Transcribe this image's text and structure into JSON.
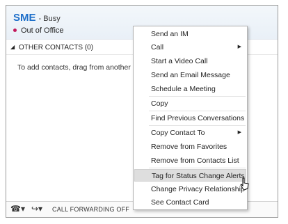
{
  "profile": {
    "name": "SME",
    "status": "- Busy",
    "note": "Out of Office",
    "note_dot_color": "#c2185b",
    "name_color": "#1e6fc9"
  },
  "group": {
    "caret": "◢",
    "label": "OTHER CONTACTS (0)"
  },
  "hint": "To add contacts, drag from another group",
  "footer": {
    "phone_icon": "phone-icon",
    "forward_icon": "call-forward-icon",
    "forwarding_text": "CALL FORWARDING OFF"
  },
  "context_menu": {
    "items": [
      {
        "label": "Send an IM"
      },
      {
        "label": "Call",
        "submenu": "▶"
      },
      {
        "label": "Start a Video Call"
      },
      {
        "label": "Send an Email Message"
      },
      {
        "label": "Schedule a Meeting"
      },
      {
        "label": "Copy"
      },
      {
        "label": "Find Previous Conversations"
      },
      {
        "label": "Copy Contact To",
        "submenu": "▶"
      },
      {
        "label": "Remove from Favorites"
      },
      {
        "label": "Remove from Contacts List"
      },
      {
        "label": "Tag for Status Change Alerts",
        "highlighted": true
      },
      {
        "label": "Change Privacy Relationship"
      },
      {
        "label": "See Contact Card"
      }
    ]
  }
}
